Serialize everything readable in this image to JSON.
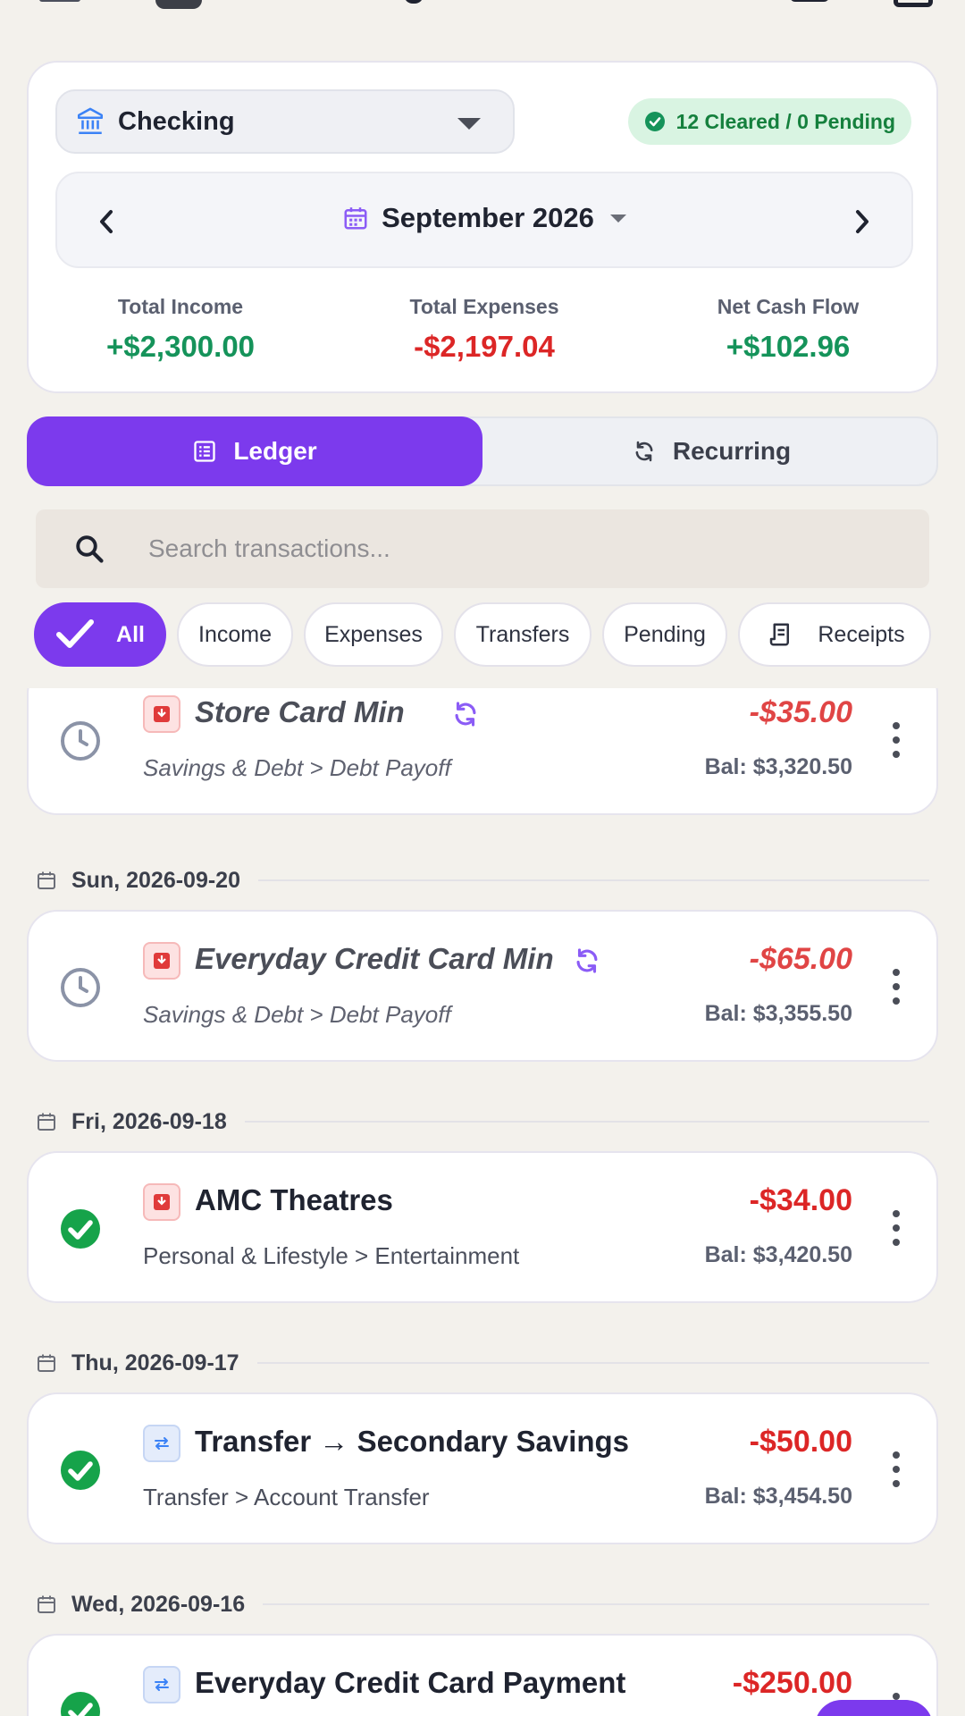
{
  "summary": {
    "account_name": "Checking",
    "status_text": "12 Cleared / 0 Pending",
    "month_label": "September 2026",
    "totals": [
      {
        "label": "Total Income",
        "value": "+$2,300.00",
        "tone": "positive"
      },
      {
        "label": "Total Expenses",
        "value": "-$2,197.04",
        "tone": "negative"
      },
      {
        "label": "Net Cash Flow",
        "value": "+$102.96",
        "tone": "positive"
      }
    ]
  },
  "view_toggle": {
    "ledger_label": "Ledger",
    "recurring_label": "Recurring",
    "selected": "Ledger"
  },
  "search": {
    "placeholder": "Search transactions...",
    "value": ""
  },
  "filters": {
    "all": "All",
    "income": "Income",
    "expenses": "Expenses",
    "transfers": "Transfers",
    "pending": "Pending",
    "receipts": "Receipts",
    "selected": "All"
  },
  "transactions": {
    "t0": {
      "payee": "Store Card Min",
      "category": "Savings & Debt > Debt Payoff",
      "amount": "-$35.00",
      "balance": "Bal: $3,320.50",
      "status": "pending",
      "recurring": true,
      "icon": "expense-icon"
    },
    "d1": "Sun, 2026-09-20",
    "t1": {
      "payee": "Everyday Credit Card Min",
      "category": "Savings & Debt > Debt Payoff",
      "amount": "-$65.00",
      "balance": "Bal: $3,355.50",
      "status": "pending",
      "recurring": true,
      "icon": "expense-icon"
    },
    "d2": "Fri, 2026-09-18",
    "t2": {
      "payee": "AMC Theatres",
      "category": "Personal & Lifestyle > Entertainment",
      "amount": "-$34.00",
      "balance": "Bal: $3,420.50",
      "status": "cleared",
      "recurring": false,
      "icon": "expense-icon"
    },
    "d3": "Thu, 2026-09-17",
    "t3": {
      "payee": "Transfer → Secondary Savings",
      "category": "Transfer > Account Transfer",
      "amount": "-$50.00",
      "balance": "Bal: $3,454.50",
      "status": "cleared",
      "recurring": false,
      "icon": "transfer-icon"
    },
    "d4": "Wed, 2026-09-16",
    "t4": {
      "payee": "Everyday Credit Card Payment",
      "amount": "-$250.00",
      "status": "cleared",
      "recurring": false,
      "icon": "transfer-icon"
    }
  },
  "colors": {
    "accent": "#7c3aed",
    "positive": "#15935a",
    "negative": "#dc2626",
    "background": "#f3f1ec"
  }
}
